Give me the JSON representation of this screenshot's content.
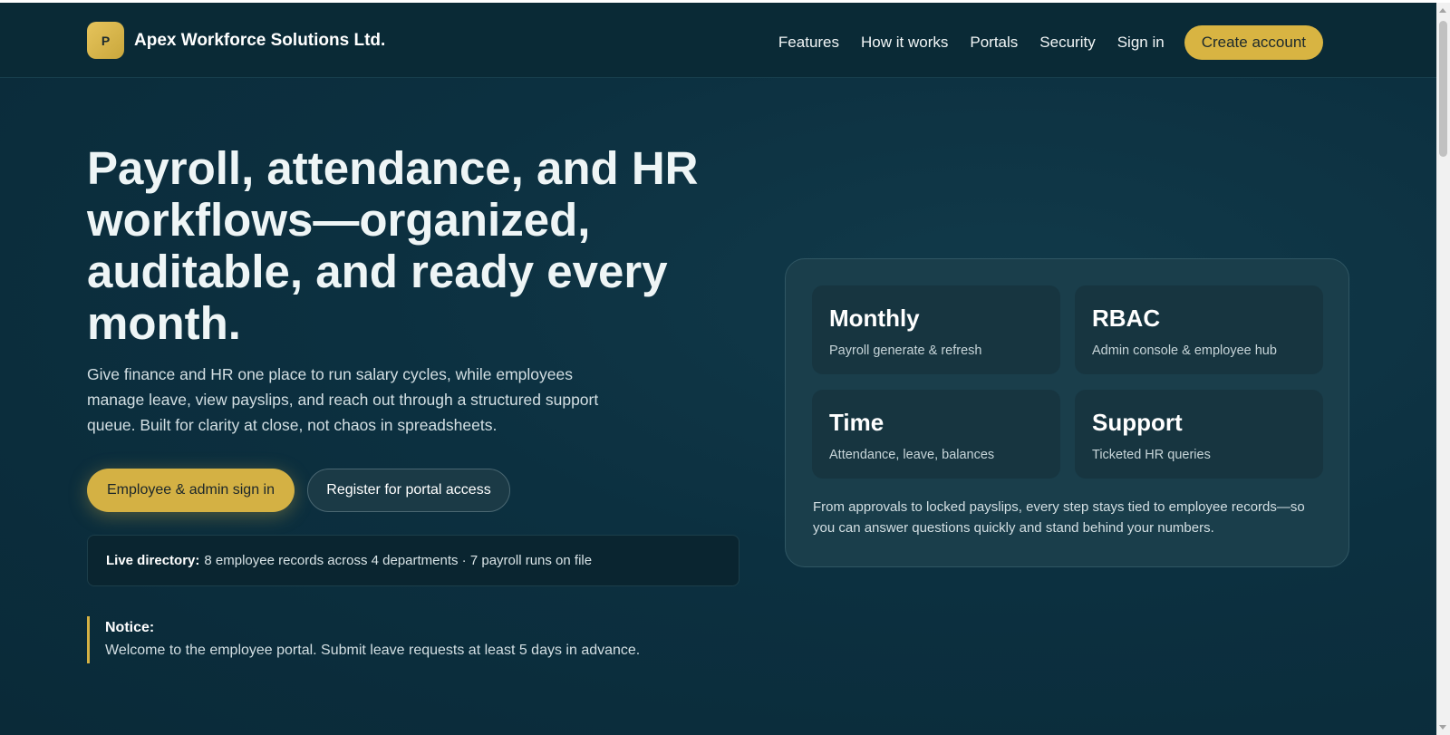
{
  "header": {
    "logo_letter": "P",
    "brand_name": "Apex Workforce Solutions Ltd.",
    "nav": [
      "Features",
      "How it works",
      "Portals",
      "Security",
      "Sign in"
    ],
    "cta": "Create account"
  },
  "hero": {
    "title": "Payroll, attendance, and HR workflows—organized, auditable, and ready every month.",
    "description": "Give finance and HR one place to run salary cycles, while employees manage leave, view payslips, and reach out through a structured support queue. Built for clarity at close, not chaos in spreadsheets.",
    "primary_button": "Employee & admin sign in",
    "secondary_button": "Register for portal access",
    "live_label": "Live directory:",
    "live_text": "8 employee records across 4 departments · 7 payroll runs on file"
  },
  "notice": {
    "title": "Notice:",
    "text": "Welcome to the employee portal. Submit leave requests at least 5 days in advance."
  },
  "panel": {
    "cards": [
      {
        "title": "Monthly",
        "subtitle": "Payroll generate & refresh"
      },
      {
        "title": "RBAC",
        "subtitle": "Admin console & employee hub"
      },
      {
        "title": "Time",
        "subtitle": "Attendance, leave, balances"
      },
      {
        "title": "Support",
        "subtitle": "Ticketed HR queries"
      }
    ],
    "footer": "From approvals to locked payslips, every step stays tied to employee records—so you can answer questions quickly and stand behind your numbers."
  },
  "colors": {
    "background": "#0c3040",
    "accent": "#d4b144",
    "panel": "#1a3e4b"
  }
}
